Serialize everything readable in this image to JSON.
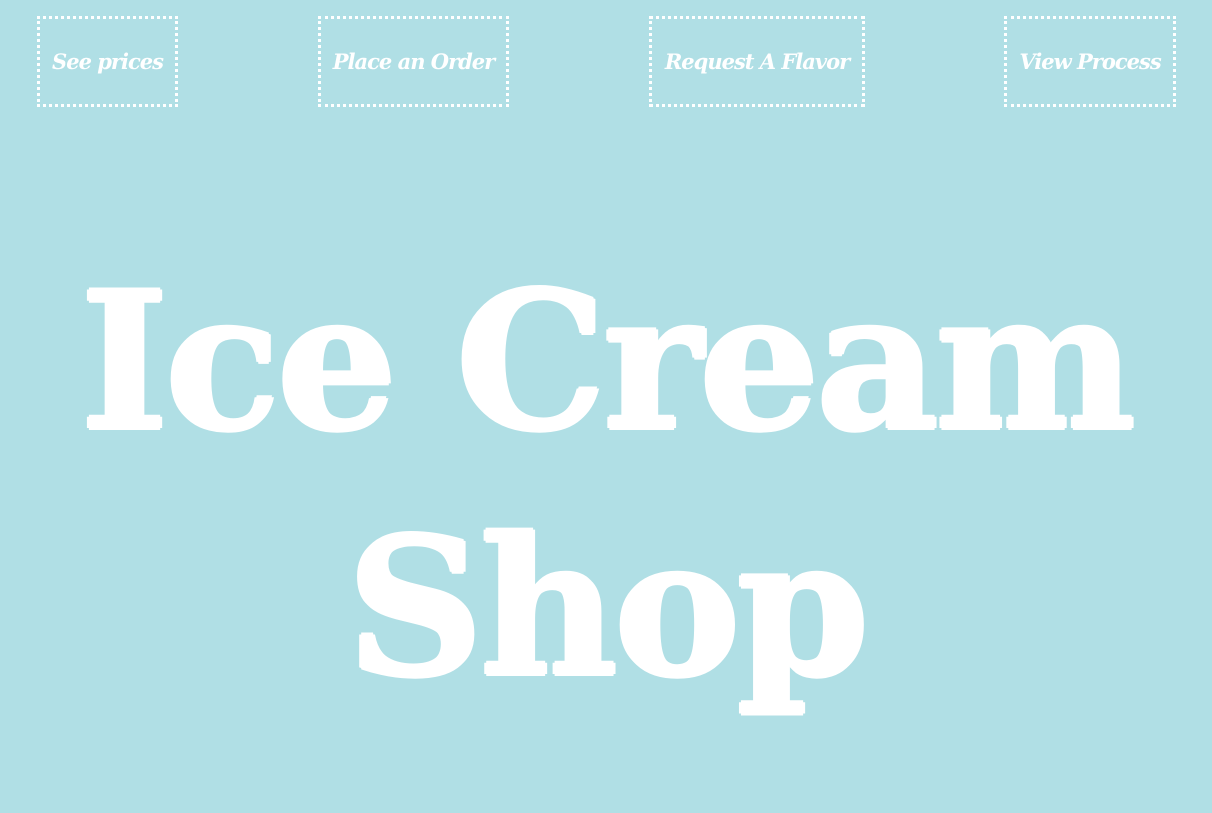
{
  "nav": {
    "items": [
      {
        "label": "See prices"
      },
      {
        "label": "Place an Order"
      },
      {
        "label": "Request A Flavor"
      },
      {
        "label": "View Process"
      }
    ]
  },
  "hero": {
    "line1": "Ice Cream",
    "line2": "Shop"
  },
  "colors": {
    "background": "#b0dfe5",
    "text": "#ffffff"
  }
}
